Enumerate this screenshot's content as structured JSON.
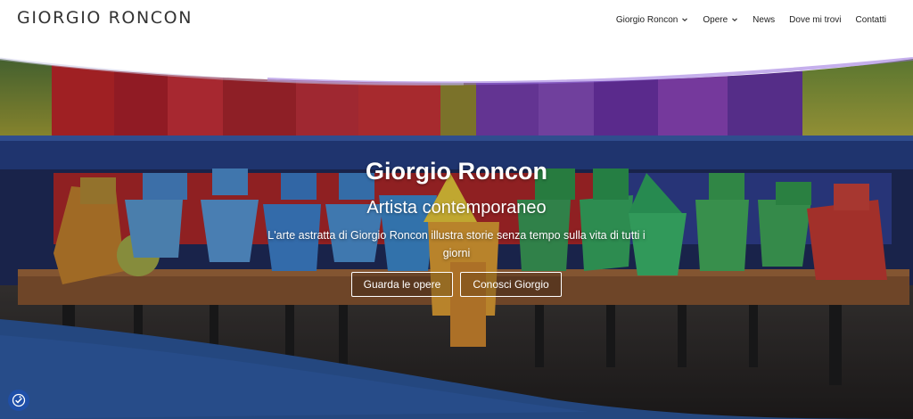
{
  "header": {
    "logo": "GIORGIO RONCON",
    "nav": [
      {
        "label": "Giorgio Roncon",
        "has_dropdown": true
      },
      {
        "label": "Opere",
        "has_dropdown": true
      },
      {
        "label": "News",
        "has_dropdown": false
      },
      {
        "label": "Dove mi trovi",
        "has_dropdown": false
      },
      {
        "label": "Contatti",
        "has_dropdown": false
      }
    ]
  },
  "hero": {
    "title": "Giorgio Roncon",
    "subtitle": "Artista contemporaneo",
    "description": "L'arte astratta di Giorgio Roncon illustra storie senza tempo sulla vita di tutti i giorni",
    "buttons": {
      "opere": "Guarda le opere",
      "giorgio": "Conosci Giorgio"
    }
  },
  "colors": {
    "accent_blue": "#24477f",
    "a11y_button": "#1f4fa8"
  },
  "icons": {
    "dropdown": "chevron-down-icon",
    "accessibility": "accessibility-icon"
  }
}
